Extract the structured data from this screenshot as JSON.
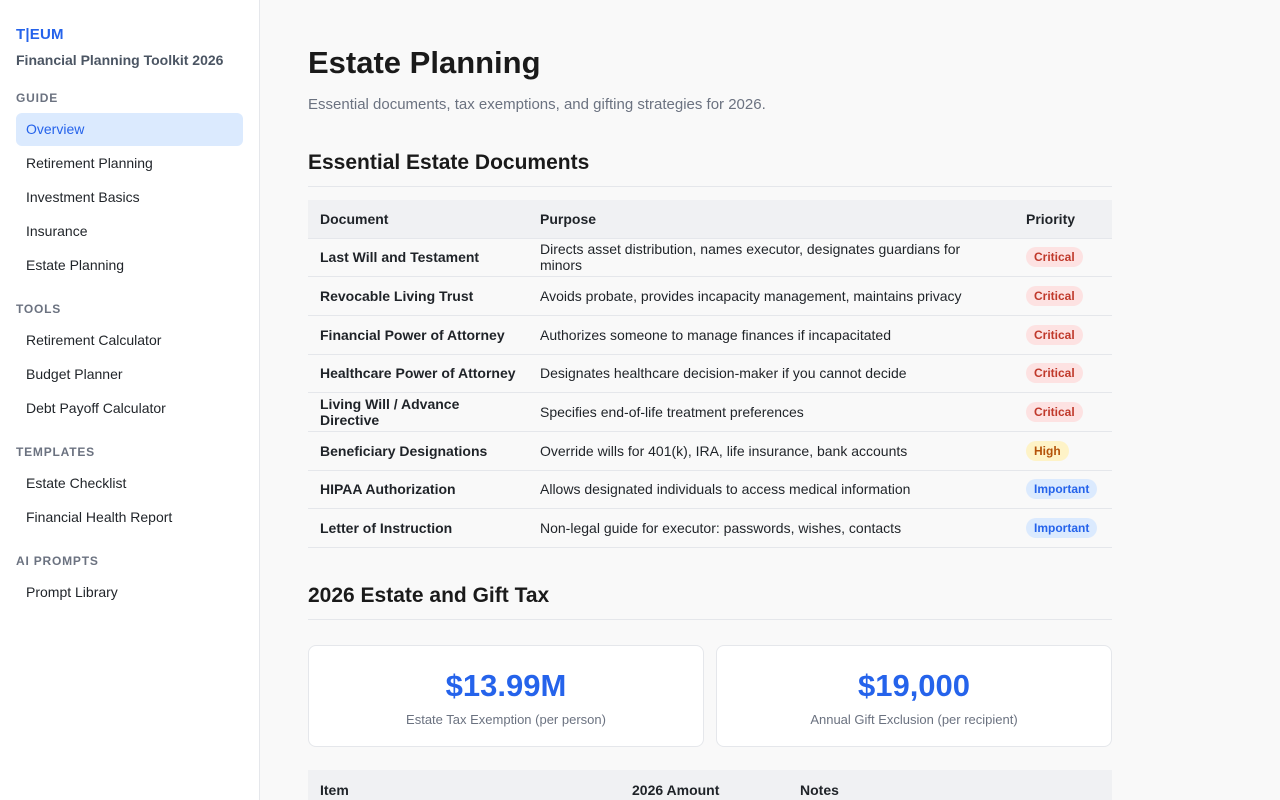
{
  "sidebar": {
    "brand": "T|EUM",
    "subtitle": "Financial Planning Toolkit 2026",
    "sections": [
      {
        "title": "GUIDE",
        "items": [
          "Overview",
          "Retirement Planning",
          "Investment Basics",
          "Insurance",
          "Estate Planning"
        ]
      },
      {
        "title": "TOOLS",
        "items": [
          "Retirement Calculator",
          "Budget Planner",
          "Debt Payoff Calculator"
        ]
      },
      {
        "title": "TEMPLATES",
        "items": [
          "Estate Checklist",
          "Financial Health Report"
        ]
      },
      {
        "title": "AI PROMPTS",
        "items": [
          "Prompt Library"
        ]
      }
    ],
    "active_item": "Overview"
  },
  "main": {
    "title": "Estate Planning",
    "subtitle": "Essential documents, tax exemptions, and gifting strategies for 2026.",
    "documents_section": {
      "title": "Essential Estate Documents",
      "columns": [
        "Document",
        "Purpose",
        "Priority"
      ],
      "rows": [
        {
          "document": "Last Will and Testament",
          "purpose": "Directs asset distribution, names executor, designates guardians for minors",
          "priority": "Critical"
        },
        {
          "document": "Revocable Living Trust",
          "purpose": "Avoids probate, provides incapacity management, maintains privacy",
          "priority": "Critical"
        },
        {
          "document": "Financial Power of Attorney",
          "purpose": "Authorizes someone to manage finances if incapacitated",
          "priority": "Critical"
        },
        {
          "document": "Healthcare Power of Attorney",
          "purpose": "Designates healthcare decision-maker if you cannot decide",
          "priority": "Critical"
        },
        {
          "document": "Living Will / Advance Directive",
          "purpose": "Specifies end-of-life treatment preferences",
          "priority": "Critical"
        },
        {
          "document": "Beneficiary Designations",
          "purpose": "Override wills for 401(k), IRA, life insurance, bank accounts",
          "priority": "High"
        },
        {
          "document": "HIPAA Authorization",
          "purpose": "Allows designated individuals to access medical information",
          "priority": "Important"
        },
        {
          "document": "Letter of Instruction",
          "purpose": "Non-legal guide for executor: passwords, wishes, contacts",
          "priority": "Important"
        }
      ]
    },
    "tax_section": {
      "title": "2026 Estate and Gift Tax",
      "stats": [
        {
          "value": "$13.99M",
          "label": "Estate Tax Exemption (per person)"
        },
        {
          "value": "$19,000",
          "label": "Annual Gift Exclusion (per recipient)"
        }
      ],
      "columns": [
        "Item",
        "2026 Amount",
        "Notes"
      ]
    }
  },
  "colors": {
    "accent": "#2563eb",
    "active_bg": "#dbeafe",
    "critical_bg": "#fde2e2",
    "critical_text": "#c0392b",
    "high_bg": "#fef3c7",
    "high_text": "#b45309",
    "important_bg": "#dbeafe",
    "important_text": "#2563eb"
  }
}
